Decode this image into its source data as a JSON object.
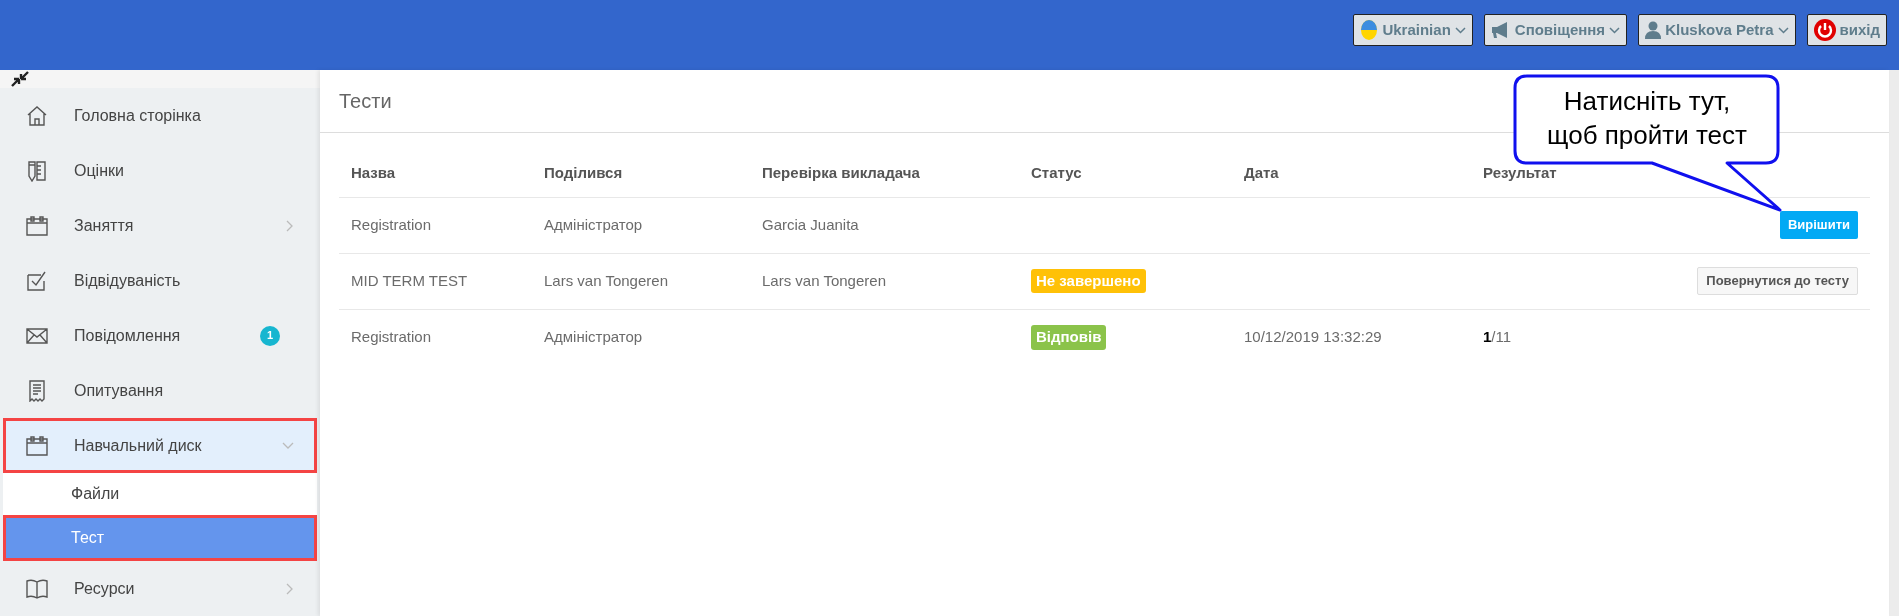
{
  "topbar": {
    "buttons": [
      {
        "label": "Ukrainian",
        "dropdown": true
      },
      {
        "label": "Сповіщення",
        "dropdown": true
      },
      {
        "label": "Kluskova Petra",
        "dropdown": true
      },
      {
        "label": "вихід",
        "dropdown": false
      }
    ]
  },
  "sidebar": {
    "items": [
      {
        "label": "Головна сторінка",
        "selected": false,
        "highlighted": false
      },
      {
        "label": "Оцінки",
        "selected": false,
        "highlighted": false
      },
      {
        "label": "Заняття",
        "selected": false,
        "highlighted": false,
        "expanded": false
      },
      {
        "label": "Відвідуваність",
        "selected": false,
        "highlighted": false
      },
      {
        "label": "Повідомлення",
        "selected": false,
        "highlighted": false,
        "badge": "1"
      },
      {
        "label": "Опитування",
        "selected": false,
        "highlighted": false
      },
      {
        "label": "Навчальний диск",
        "selected": false,
        "highlighted": true,
        "expanded": true,
        "children": [
          {
            "label": "Файли",
            "selected": false,
            "highlighted": false
          },
          {
            "label": "Тест",
            "selected": true,
            "highlighted": true
          }
        ]
      },
      {
        "label": "Ресурси",
        "selected": false,
        "highlighted": false,
        "expanded": false
      }
    ]
  },
  "page": {
    "title": "Тести"
  },
  "table": {
    "columns": [
      "Назва",
      "Поділився",
      "Перевірка викладача",
      "Статус",
      "Дата",
      "Результат"
    ],
    "rows": [
      {
        "name": "Registration",
        "shared_by": "Адміністратор",
        "reviewer": "Garcia Juanita",
        "action": {
          "kind": "primary",
          "label": "Вирішити"
        }
      },
      {
        "name": "MID TERM TEST",
        "shared_by": "Lars van Tongeren",
        "reviewer": "Lars van Tongeren",
        "status": {
          "label": "Не завершено",
          "color": "#ffc107"
        },
        "action": {
          "kind": "default",
          "label": "Повернутися до тесту"
        }
      },
      {
        "name": "Registration",
        "shared_by": "Адміністратор",
        "status": {
          "label": "Відповів",
          "color": "#8bc34a"
        },
        "date": "10/12/2019 13:32:29",
        "result": "**1**/11"
      }
    ]
  },
  "callout": {
    "text": "Натисніть тут, щоб пройти тест"
  }
}
